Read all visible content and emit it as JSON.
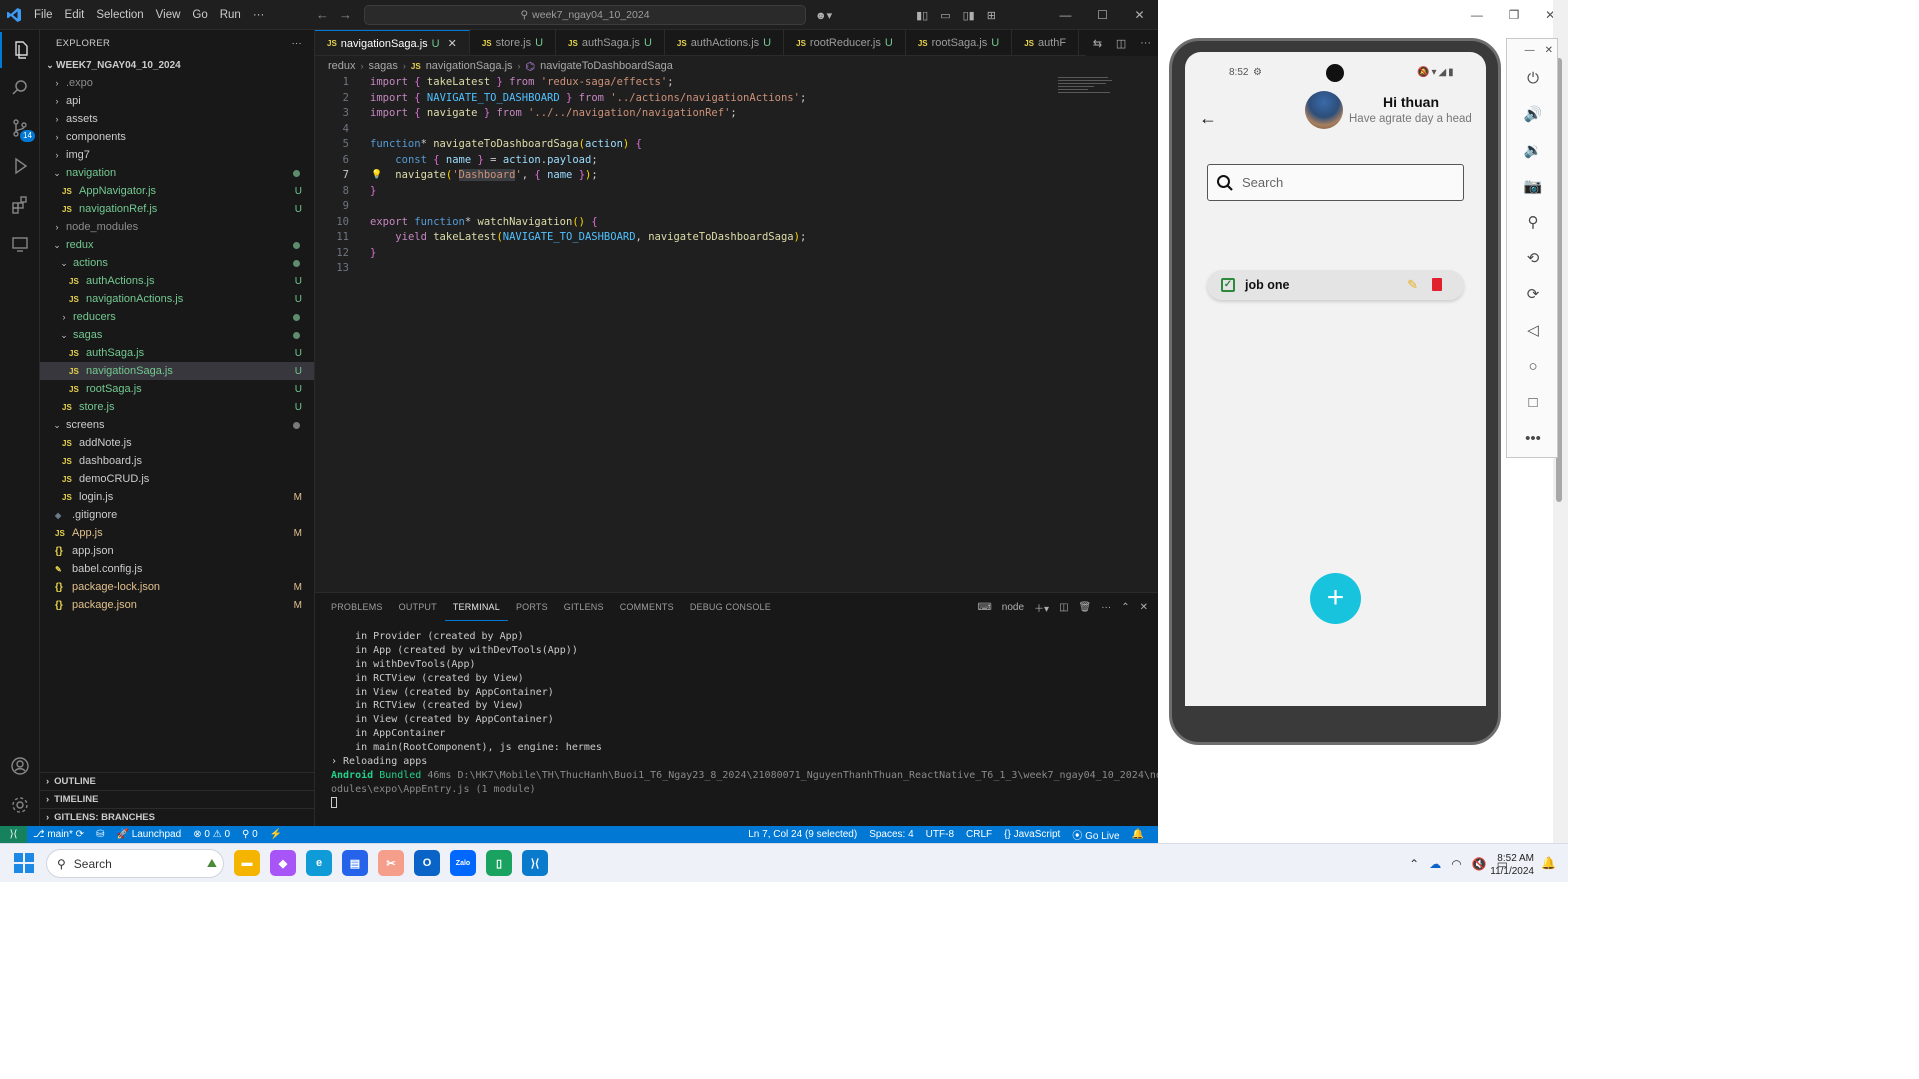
{
  "titlebar": {
    "menu": [
      "File",
      "Edit",
      "Selection",
      "View",
      "Go",
      "Run",
      "···"
    ],
    "search": "week7_ngay04_10_2024"
  },
  "activity": {
    "source_control_badge": "14"
  },
  "explorer": {
    "header": "EXPLORER",
    "root": "WEEK7_NGAY04_10_2024",
    "items": [
      {
        "label": ".expo",
        "type": "folder",
        "indent": 1,
        "open": false,
        "style": "dim",
        "status": ""
      },
      {
        "label": "api",
        "type": "folder",
        "indent": 1,
        "open": false,
        "style": "",
        "status": ""
      },
      {
        "label": "assets",
        "type": "folder",
        "indent": 1,
        "open": false,
        "style": "",
        "status": ""
      },
      {
        "label": "components",
        "type": "folder",
        "indent": 1,
        "open": false,
        "style": "",
        "status": ""
      },
      {
        "label": "img7",
        "type": "folder",
        "indent": 1,
        "open": false,
        "style": "",
        "status": ""
      },
      {
        "label": "navigation",
        "type": "folder",
        "indent": 1,
        "open": true,
        "style": "green",
        "status": "dot"
      },
      {
        "label": "AppNavigator.js",
        "type": "js",
        "indent": 2,
        "style": "green",
        "status": "U"
      },
      {
        "label": "navigationRef.js",
        "type": "js",
        "indent": 2,
        "style": "green",
        "status": "U"
      },
      {
        "label": "node_modules",
        "type": "folder",
        "indent": 1,
        "open": false,
        "style": "dim",
        "status": ""
      },
      {
        "label": "redux",
        "type": "folder",
        "indent": 1,
        "open": true,
        "style": "green",
        "status": "dot"
      },
      {
        "label": "actions",
        "type": "folder",
        "indent": 2,
        "open": true,
        "style": "green",
        "status": "dot"
      },
      {
        "label": "authActions.js",
        "type": "js",
        "indent": 3,
        "style": "green",
        "status": "U"
      },
      {
        "label": "navigationActions.js",
        "type": "js",
        "indent": 3,
        "style": "green",
        "status": "U"
      },
      {
        "label": "reducers",
        "type": "folder",
        "indent": 2,
        "open": false,
        "style": "green",
        "status": "dot"
      },
      {
        "label": "sagas",
        "type": "folder",
        "indent": 2,
        "open": true,
        "style": "green",
        "status": "dot"
      },
      {
        "label": "authSaga.js",
        "type": "js",
        "indent": 3,
        "style": "green",
        "status": "U"
      },
      {
        "label": "navigationSaga.js",
        "type": "js",
        "indent": 3,
        "style": "green",
        "status": "U",
        "selected": true
      },
      {
        "label": "rootSaga.js",
        "type": "js",
        "indent": 3,
        "style": "green",
        "status": "U"
      },
      {
        "label": "store.js",
        "type": "js",
        "indent": 2,
        "style": "green",
        "status": "U"
      },
      {
        "label": "screens",
        "type": "folder",
        "indent": 1,
        "open": true,
        "style": "",
        "status": "dotgray"
      },
      {
        "label": "addNote.js",
        "type": "js",
        "indent": 2,
        "style": "",
        "status": ""
      },
      {
        "label": "dashboard.js",
        "type": "js",
        "indent": 2,
        "style": "",
        "status": ""
      },
      {
        "label": "demoCRUD.js",
        "type": "js",
        "indent": 2,
        "style": "",
        "status": ""
      },
      {
        "label": "login.js",
        "type": "js",
        "indent": 2,
        "style": "",
        "status": "M"
      },
      {
        "label": ".gitignore",
        "type": "git",
        "indent": 1,
        "style": "",
        "status": ""
      },
      {
        "label": "App.js",
        "type": "js",
        "indent": 1,
        "style": "mod",
        "status": "M"
      },
      {
        "label": "app.json",
        "type": "json",
        "indent": 1,
        "style": "",
        "status": ""
      },
      {
        "label": "babel.config.js",
        "type": "babel",
        "indent": 1,
        "style": "",
        "status": ""
      },
      {
        "label": "package-lock.json",
        "type": "json",
        "indent": 1,
        "style": "mod",
        "status": "M"
      },
      {
        "label": "package.json",
        "type": "json",
        "indent": 1,
        "style": "mod",
        "status": "M"
      }
    ],
    "sections": [
      "OUTLINE",
      "TIMELINE",
      "GITLENS: BRANCHES"
    ]
  },
  "tabs": [
    {
      "label": "navigationSaga.js",
      "status": "U",
      "active": true
    },
    {
      "label": "store.js",
      "status": "U",
      "active": false
    },
    {
      "label": "authSaga.js",
      "status": "U",
      "active": false
    },
    {
      "label": "authActions.js",
      "status": "U",
      "active": false
    },
    {
      "label": "rootReducer.js",
      "status": "U",
      "active": false
    },
    {
      "label": "rootSaga.js",
      "status": "U",
      "active": false
    },
    {
      "label": "authF",
      "status": "",
      "active": false
    }
  ],
  "breadcrumb": [
    "redux",
    "sagas",
    "navigationSaga.js",
    "navigateToDashboardSaga"
  ],
  "code_lines": [
    "import { takeLatest } from 'redux-saga/effects';",
    "import { NAVIGATE_TO_DASHBOARD } from '../actions/navigationActions';",
    "import { navigate } from '../../navigation/navigationRef';",
    "",
    "function* navigateToDashboardSaga(action) {",
    "    const { name } = action.payload;",
    "    navigate('Dashboard', { name });",
    "}",
    "",
    "export function* watchNavigation() {",
    "    yield takeLatest(NAVIGATE_TO_DASHBOARD, navigateToDashboardSaga);",
    "}",
    ""
  ],
  "active_line": 7,
  "panel": {
    "tabs": [
      "PROBLEMS",
      "OUTPUT",
      "TERMINAL",
      "PORTS",
      "GITLENS",
      "COMMENTS",
      "DEBUG CONSOLE"
    ],
    "active_tab": "TERMINAL",
    "shell": "node",
    "terminal_lines": [
      "    in Provider (created by App)",
      "    in App (created by withDevTools(App))",
      "    in withDevTools(App)",
      "    in RCTView (created by View)",
      "    in View (created by AppContainer)",
      "    in RCTView (created by View)",
      "    in View (created by AppContainer)",
      "    in AppContainer",
      "    in main(RootComponent), js engine: hermes",
      "› Reloading apps"
    ],
    "bundle_prefix": "Android",
    "bundle_word": "Bundled",
    "bundle_time": "46ms",
    "bundle_path_1": "D:\\HK7\\Mobile\\TH\\ThucHanh\\Buoi1_T6_Ngay23_8_2024\\21080071_NguyenThanhThuan_ReactNative_T6_1_3\\week7_ngay04_10_2024\\node_m",
    "bundle_path_2": "odules\\expo\\AppEntry.js (1 module)"
  },
  "statusbar": {
    "branch": "main*",
    "launchpad": "Launchpad",
    "errors": "0",
    "warnings": "0",
    "ports": "0",
    "position": "Ln 7, Col 24 (9 selected)",
    "spaces": "Spaces: 4",
    "encoding": "UTF-8",
    "eol": "CRLF",
    "language": "JavaScript",
    "golive": "Go Live"
  },
  "phone": {
    "time": "8:52",
    "user_name": "Hi thuan",
    "subtitle": "Have agrate day a head",
    "search_placeholder": "Search",
    "job_title": "job one",
    "fab": "+"
  },
  "taskbar": {
    "search": "Search",
    "time": "8:52 AM",
    "date": "11/1/2024"
  }
}
